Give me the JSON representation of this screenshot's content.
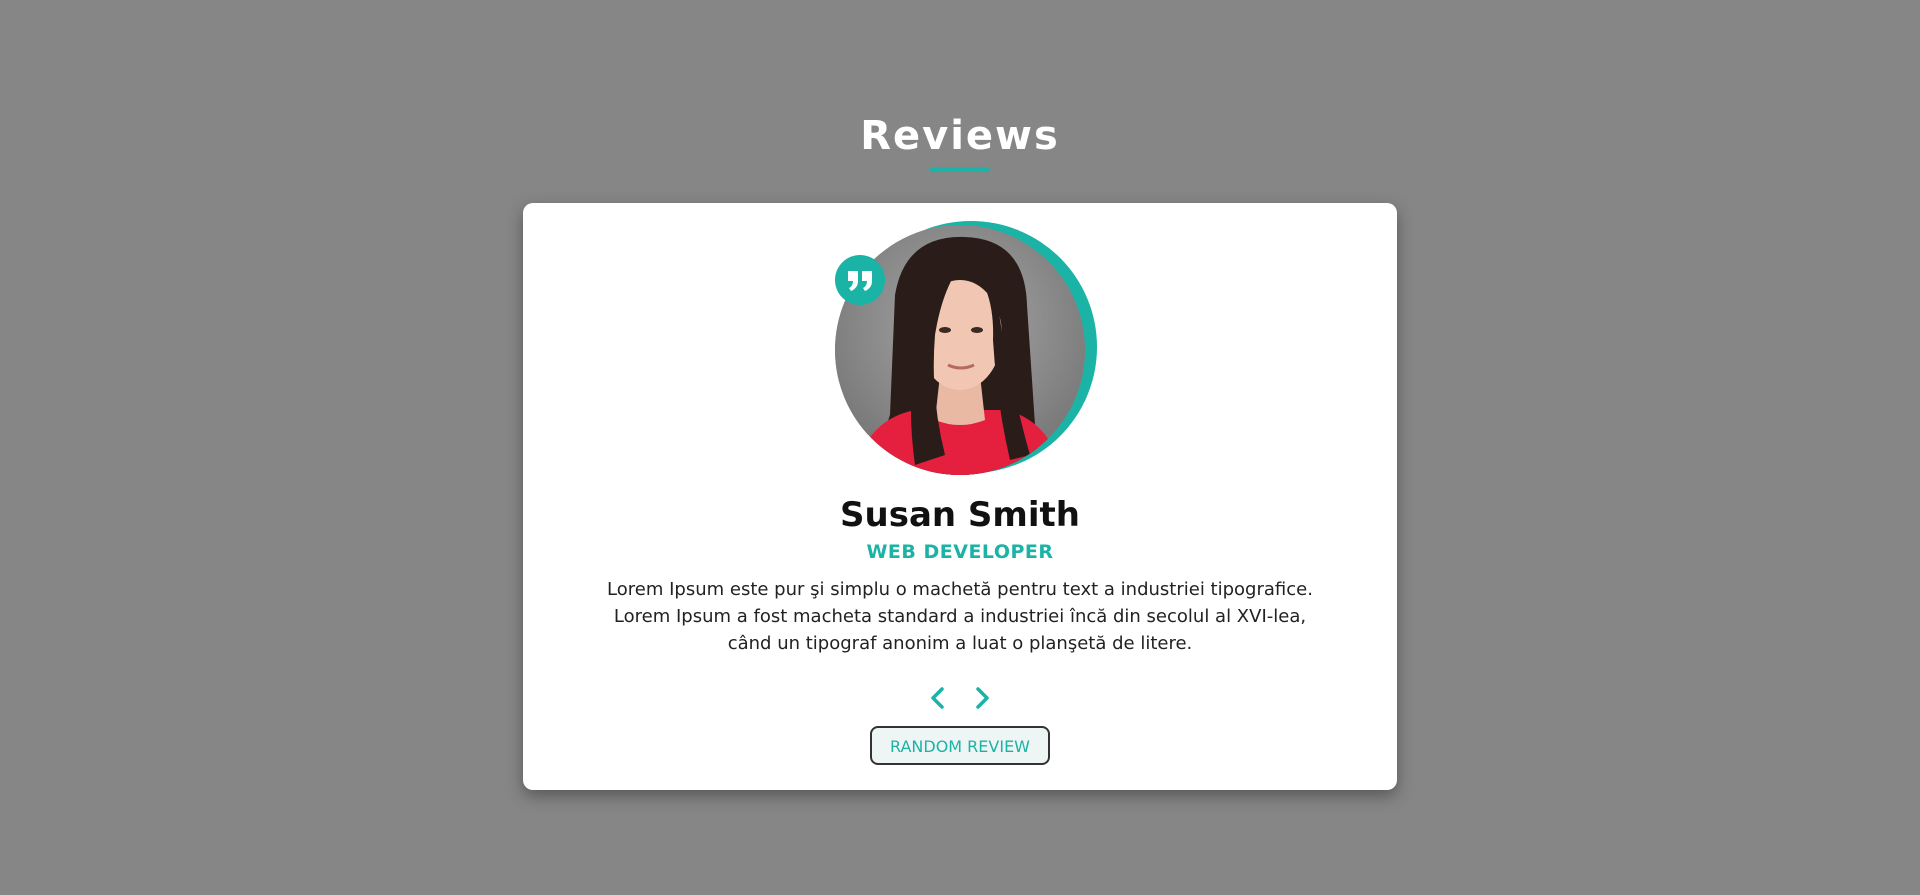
{
  "section": {
    "title": "Reviews"
  },
  "review": {
    "author": "Susan Smith",
    "job": "WEB DEVELOPER",
    "text": "Lorem Ipsum este pur şi simplu o machetă pentru text a industriei tipografice. Lorem Ipsum a fost macheta standard a industriei încă din secolul al XVI-lea, când un tipograf anonim a luat o planşetă de litere."
  },
  "controls": {
    "prev_icon": "chevron-left-icon",
    "next_icon": "chevron-right-icon",
    "random_label": "RANDOM REVIEW"
  },
  "icons": {
    "quote": "quote-right-icon"
  },
  "colors": {
    "background": "#868686",
    "accent": "#1ab3a6",
    "card": "#ffffff",
    "title": "#ffffff"
  }
}
